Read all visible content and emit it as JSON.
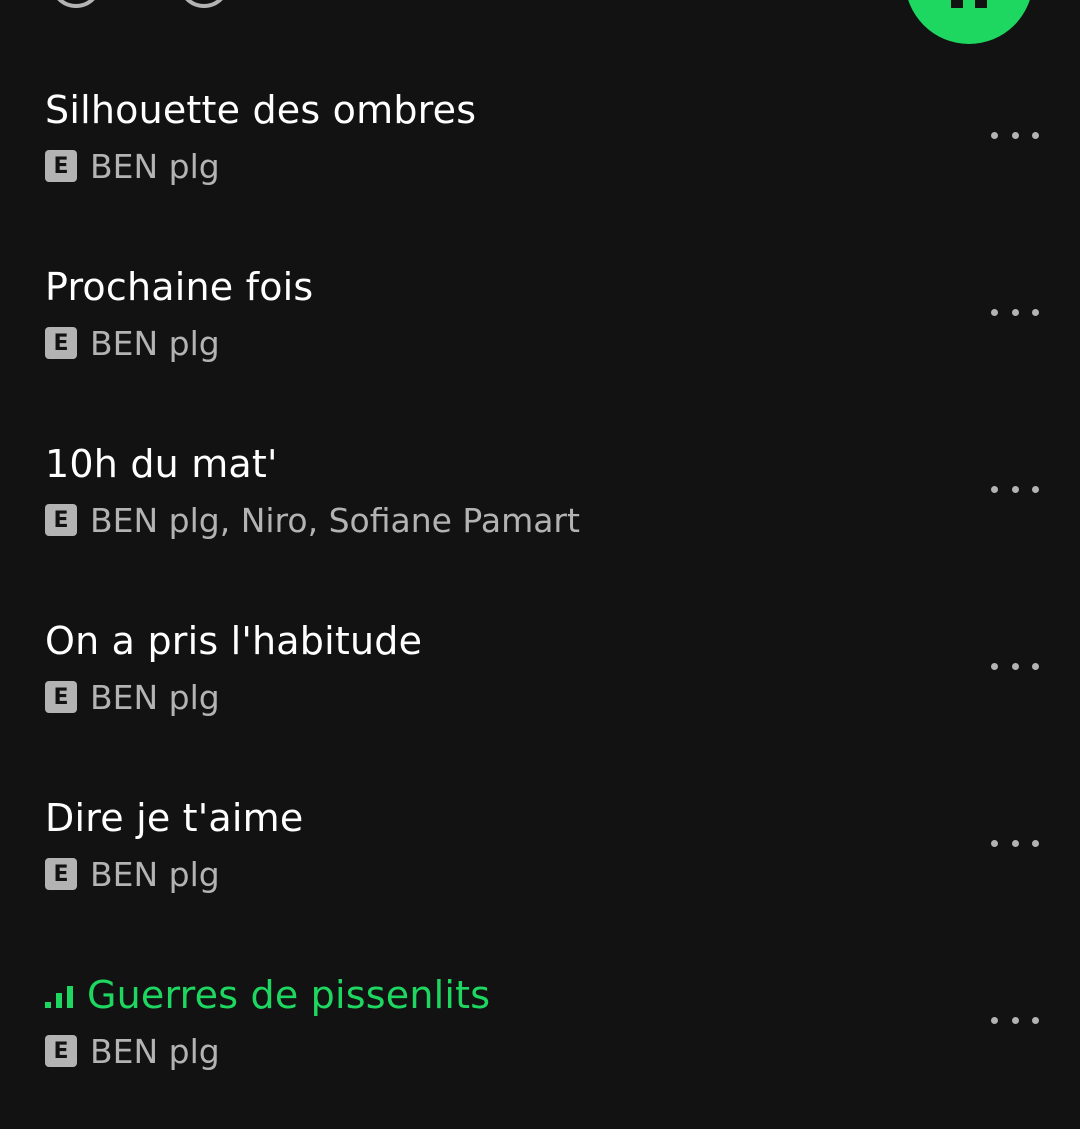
{
  "colors": {
    "background": "#121212",
    "accent_green": "#1ed760",
    "text_primary": "#ffffff",
    "text_secondary": "#b3b3b3"
  },
  "explicit_label": "E",
  "tracks": [
    {
      "title": "Silhouette des ombres",
      "artist": "BEN plg",
      "explicit": true,
      "playing": false
    },
    {
      "title": "Prochaine fois",
      "artist": "BEN plg",
      "explicit": true,
      "playing": false
    },
    {
      "title": "10h du mat'",
      "artist": "BEN plg, Niro, Sofiane Pamart",
      "explicit": true,
      "playing": false
    },
    {
      "title": "On a pris l'habitude",
      "artist": "BEN plg",
      "explicit": true,
      "playing": false
    },
    {
      "title": "Dire je t'aime",
      "artist": "BEN plg",
      "explicit": true,
      "playing": false
    },
    {
      "title": "Guerres de pissenlits",
      "artist": "BEN plg",
      "explicit": true,
      "playing": true
    }
  ]
}
